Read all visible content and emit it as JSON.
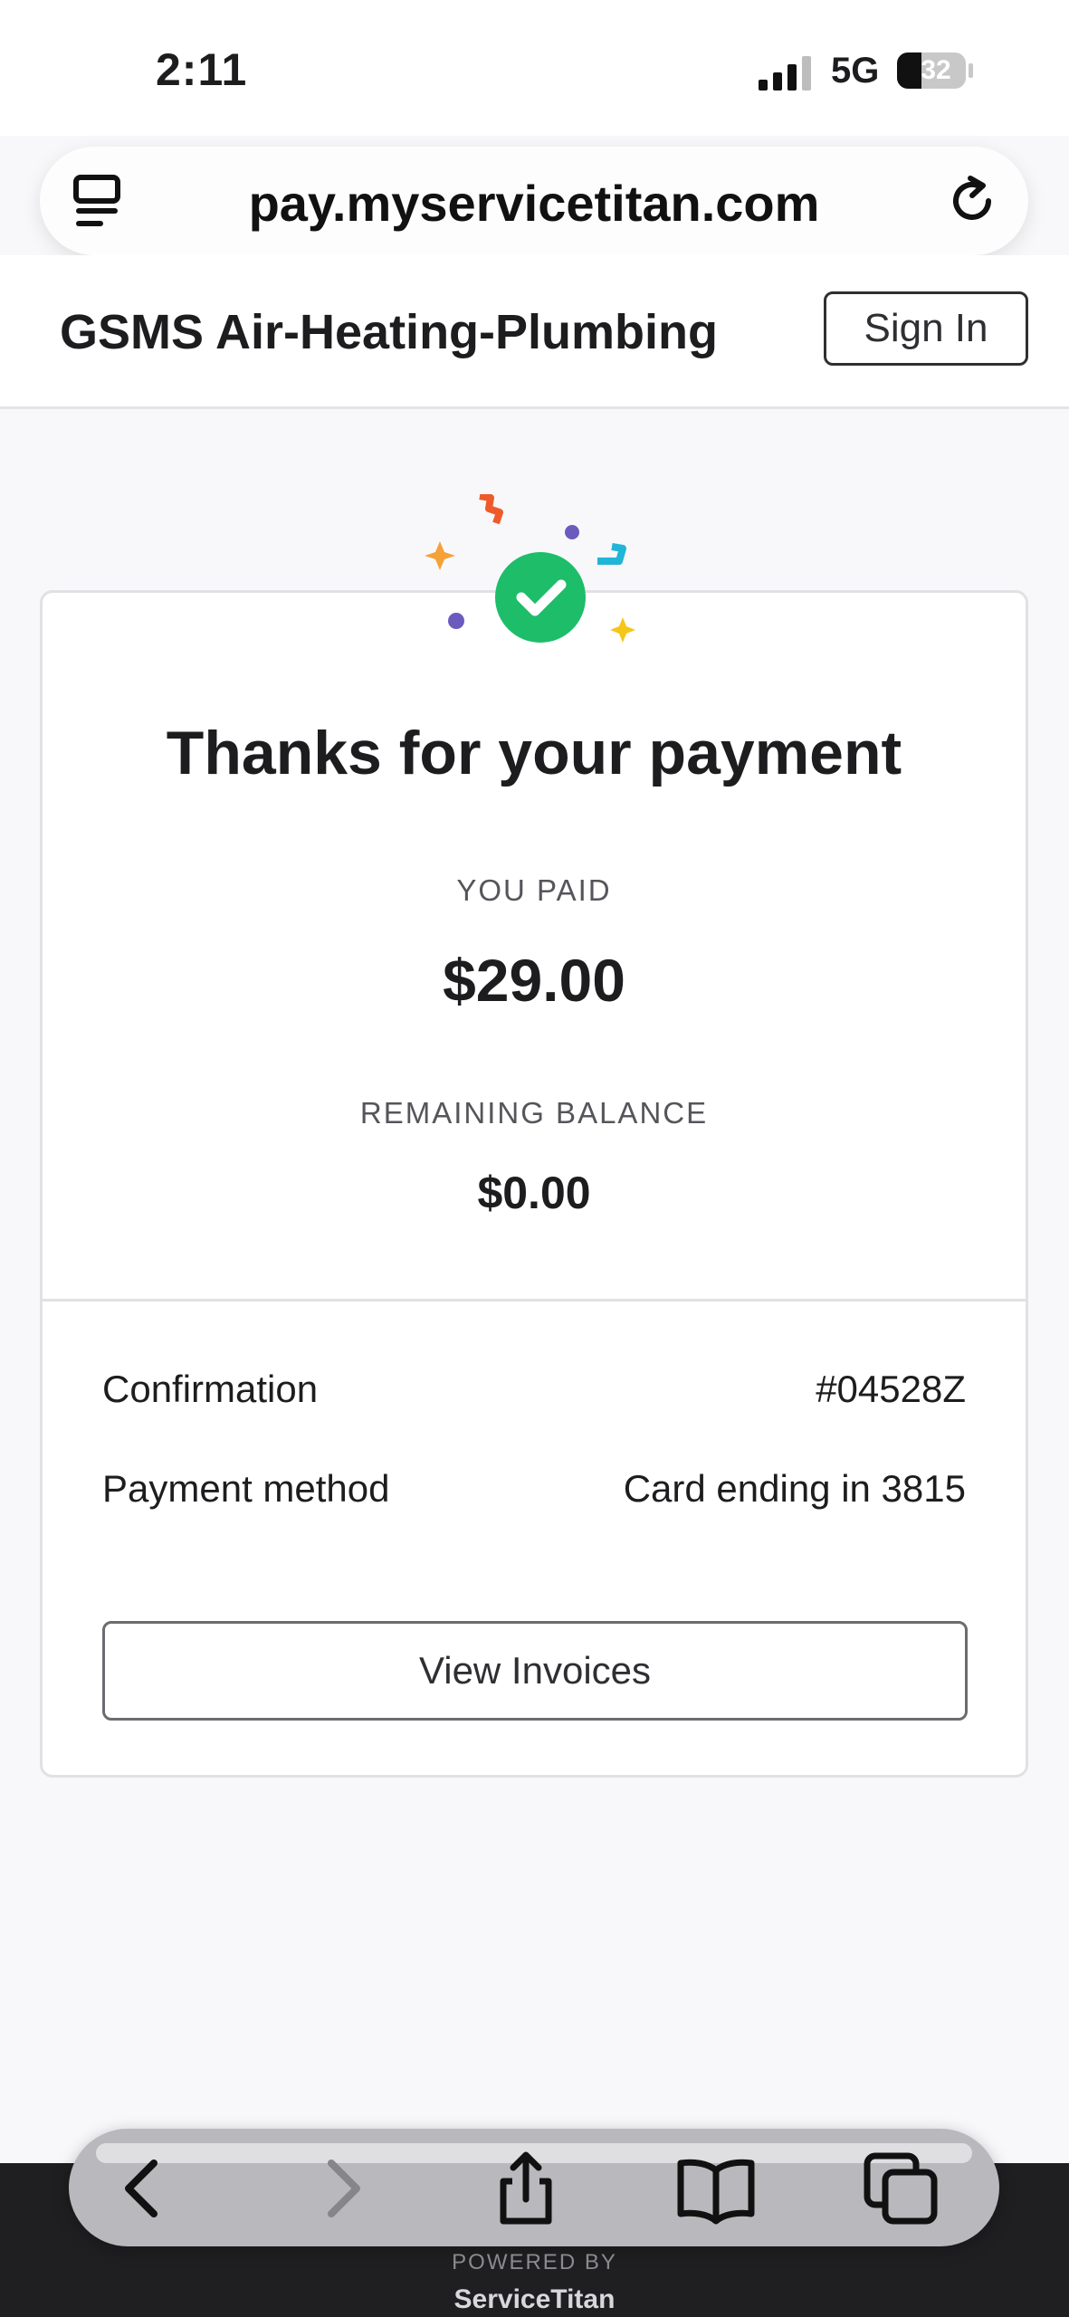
{
  "status_bar": {
    "time": "2:11",
    "network": "5G",
    "battery": "32"
  },
  "browser": {
    "url": "pay.myservicetitan.com",
    "tabs_icon": "tab-overview-icon",
    "reload_icon": "reload-icon"
  },
  "site_header": {
    "business_name": "GSMS Air-Heating-Plumbing",
    "sign_in_label": "Sign In"
  },
  "confirmation": {
    "heading": "Thanks for your payment",
    "you_paid_label": "YOU PAID",
    "paid_amount": "$29.00",
    "remaining_label": "REMAINING BALANCE",
    "remaining_amount": "$0.00",
    "rows": [
      {
        "label": "Confirmation",
        "value": "#04528Z"
      },
      {
        "label": "Payment method",
        "value": "Card ending in 3815"
      }
    ],
    "view_invoices_label": "View Invoices",
    "accent_color": "#1dbd6a"
  },
  "toolbar": {
    "icons": [
      "back-icon",
      "forward-icon",
      "share-icon",
      "bookmarks-icon",
      "tabs-icon"
    ]
  },
  "footer": {
    "powered_by": "POWERED BY",
    "brand": "ServiceTitan"
  }
}
